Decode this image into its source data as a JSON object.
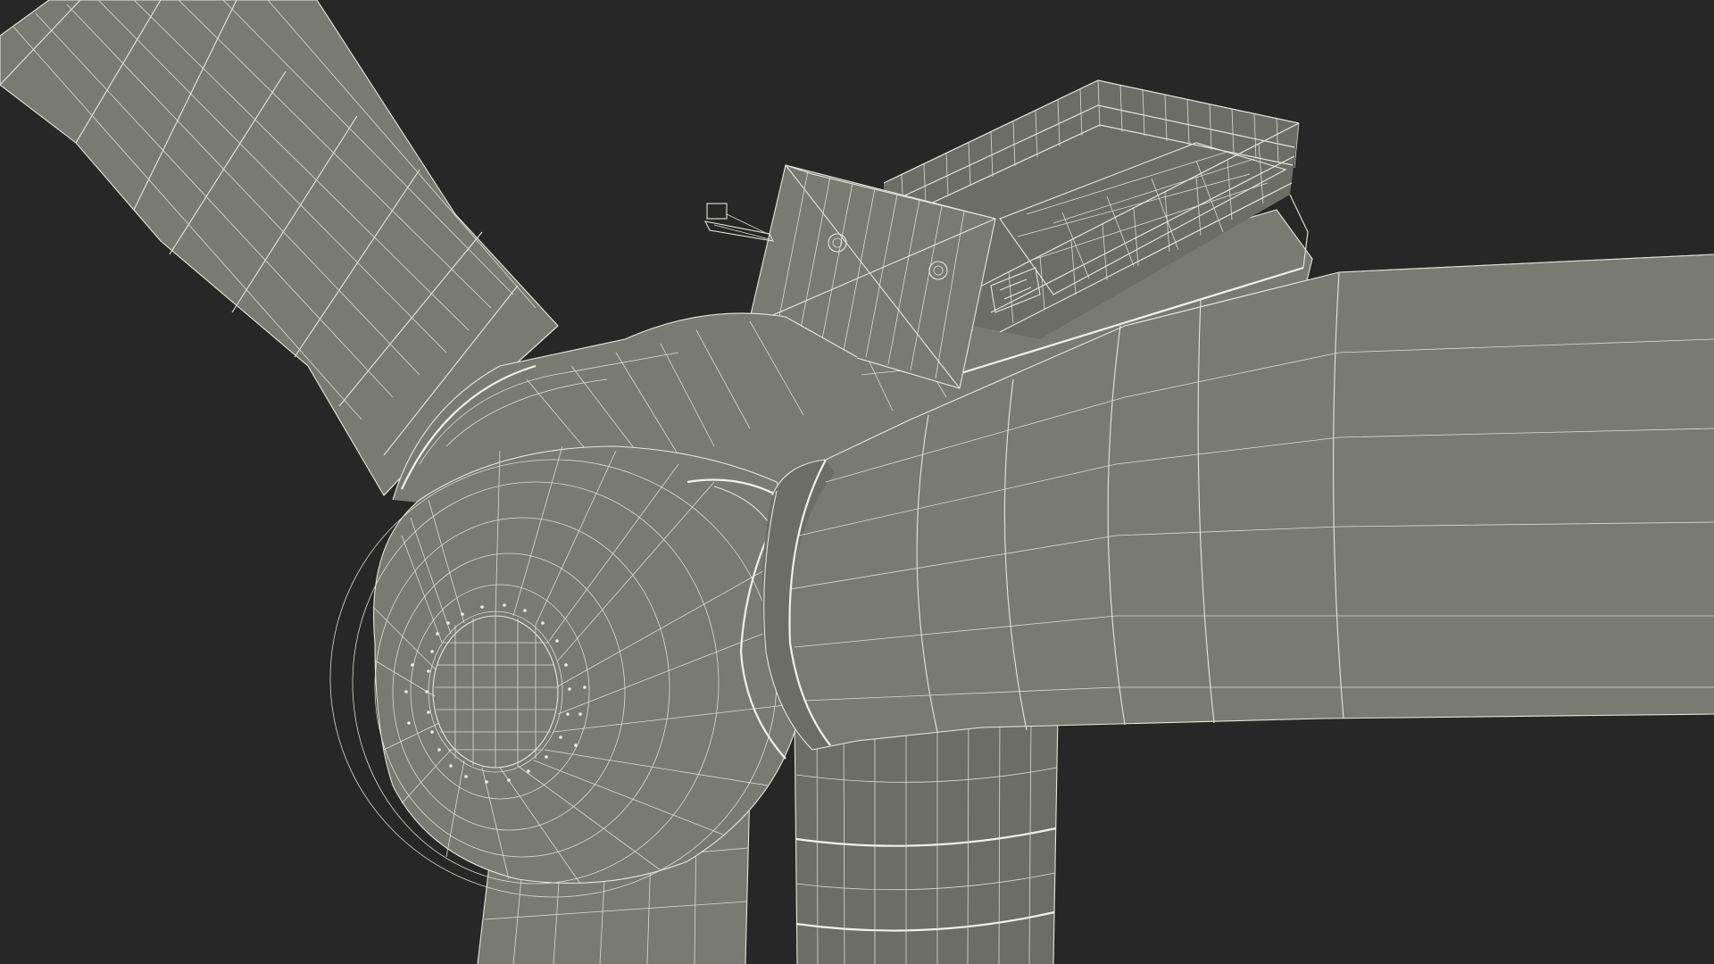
{
  "scene": {
    "subject": "wind-turbine-wireframe",
    "view": "rotor-hub-nacelle-closeup",
    "background_color": "#272727",
    "mesh_color": "#797a72",
    "wire_color": "#e6e6da"
  }
}
